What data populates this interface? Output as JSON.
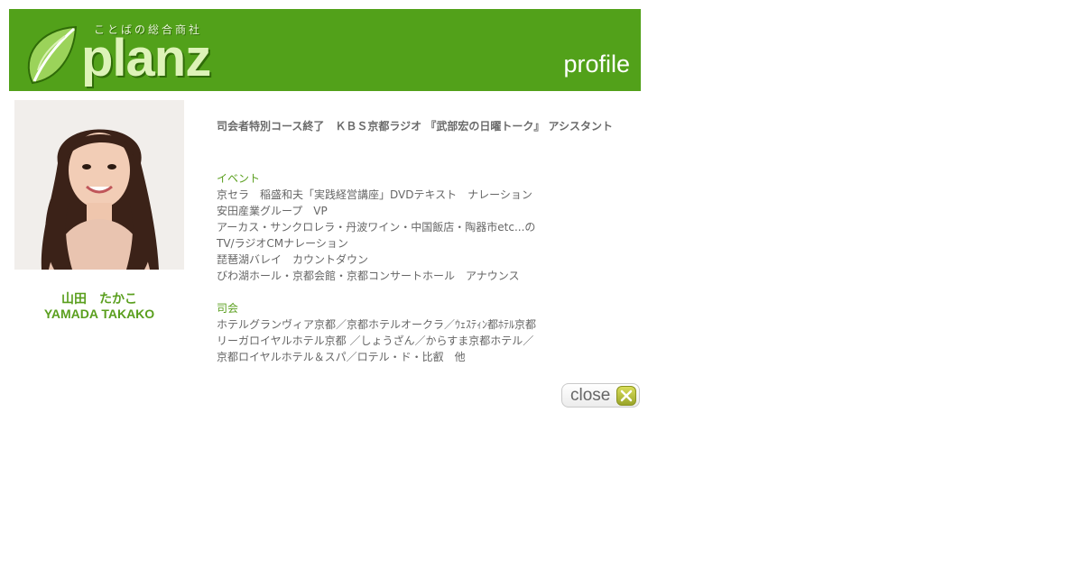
{
  "header": {
    "brand": "planz",
    "tagline": "ことばの総合商社",
    "page_label": "profile"
  },
  "profile": {
    "name_jp": "山田　たかこ",
    "name_en": "YAMADA TAKAKO",
    "headline": "司会者特別コース終了　ＫＢＳ京都ラジオ 『武部宏の日曜トーク』 アシスタント",
    "sections": [
      {
        "title": "イベント",
        "lines": [
          "京セラ　稲盛和夫「実践経営講座」DVDテキスト　ナレーション",
          "安田産業グループ　VP",
          "アーカス・サンクロレラ・丹波ワイン・中国飯店・陶器市etc...の",
          "TV/ラジオCMナレーション",
          "琵琶湖バレイ　カウントダウン",
          "びわ湖ホール・京都会館・京都コンサートホール　アナウンス"
        ]
      },
      {
        "title": "司会",
        "lines": [
          "ホテルグランヴィア京都／京都ホテルオークラ／ｳｪｽﾃｨﾝ都ﾎﾃﾙ京都",
          "リーガロイヤルホテル京都 ／しょうざん／からすま京都ホテル／",
          "京都ロイヤルホテル＆スパ／ロテル・ド・比叡　他"
        ]
      }
    ]
  },
  "close_button": {
    "label": "close"
  }
}
